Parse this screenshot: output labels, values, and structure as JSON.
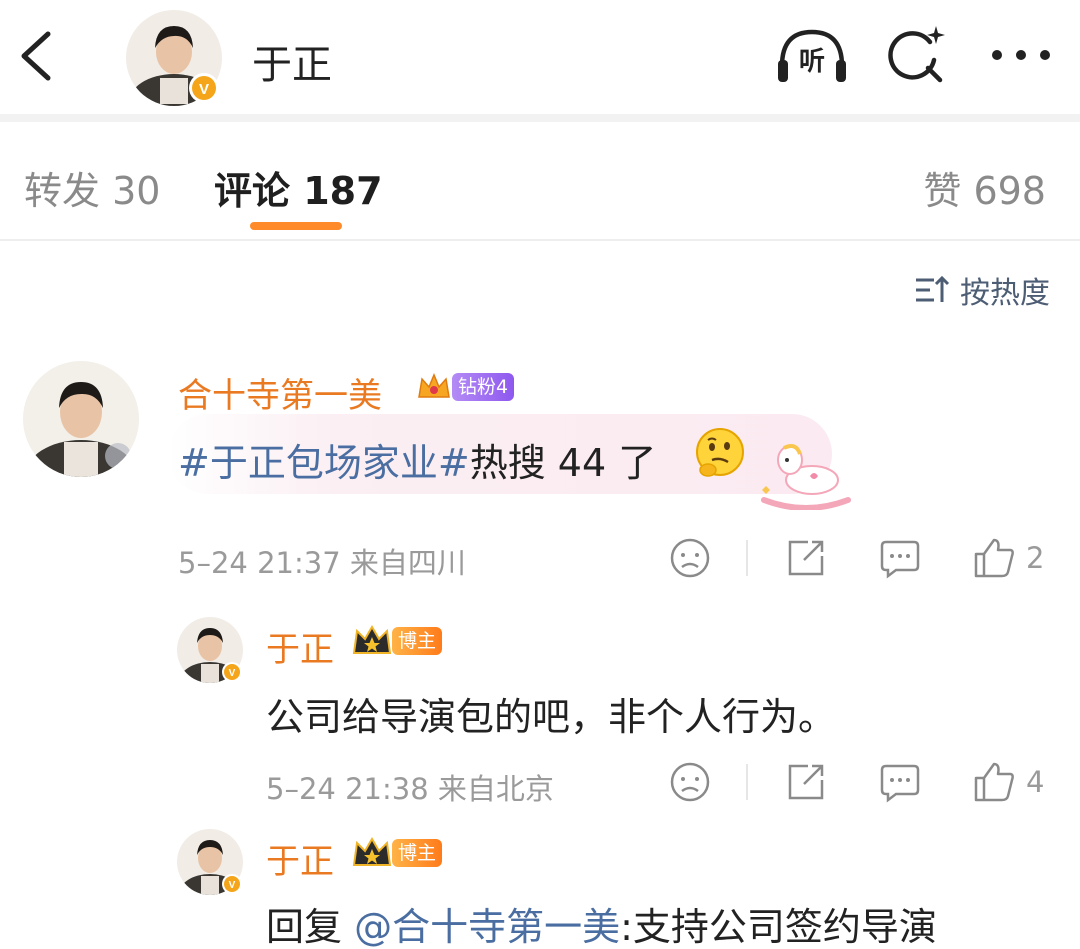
{
  "header": {
    "name": "于正",
    "icons": [
      "back-icon",
      "listen-icon",
      "search-icon",
      "more-icon"
    ],
    "listen_label": "听"
  },
  "tabs": {
    "forward": "转发 30",
    "comment": "评论 187",
    "like": "赞 698"
  },
  "sort": {
    "label": "按热度"
  },
  "colors": {
    "accent": "#ff8a2a",
    "username": "#ea7a22",
    "link": "#4a6ea1",
    "meta": "#9a9a9a"
  },
  "comments": [
    {
      "user": "合十寺第一美",
      "badge": "钻粉4",
      "text_hashtag": "#于正包场家业#",
      "text_rest": "热搜 44 了",
      "meta": "5–24 21:37  来自四川",
      "likes": "2"
    },
    {
      "user": "于正",
      "badge": "博主",
      "text": "公司给导演包的吧，非个人行为。",
      "meta": "5–24 21:38  来自北京",
      "likes": "4"
    },
    {
      "user": "于正",
      "badge": "博主",
      "text_prefix": "回复 ",
      "text_mention": "@合十寺第一美",
      "text_rest": ":支持公司签约导演"
    }
  ]
}
